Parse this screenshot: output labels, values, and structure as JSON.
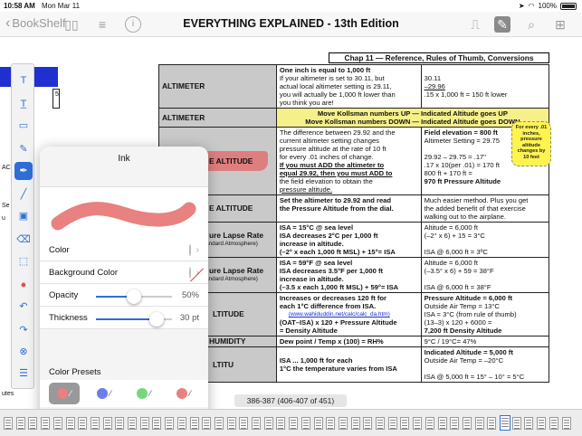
{
  "status": {
    "time": "10:58 AM",
    "date": "Mon Mar 11",
    "battery": "100%"
  },
  "nav": {
    "back_label": "BookShelf",
    "title": "EVERYTHING EXPLAINED - 13th Edition",
    "icons": [
      "book-icon",
      "list-icon",
      "info-icon",
      "bookmark-icon",
      "edit-icon",
      "search-icon",
      "grid-icon"
    ]
  },
  "sheet": {
    "chapter": "Chap 11 — Reference, Rules of Thumb, Conversions",
    "rows": [
      {
        "head": "ALTIMETER",
        "mid": [
          "One inch is equal to 1,000 ft",
          "If your altimeter is set to 30.11, but",
          "actual local altimeter setting is 29.11,",
          "you will actually be 1,000 ft lower than",
          "you think you are!"
        ],
        "right": [
          "  30.11",
          " –29.96",
          "  .15 x 1,000 ft = 150 ft lower"
        ]
      },
      {
        "head": "ALTIMETER",
        "mid": [
          "Move Kollsman numbers UP — Indicated Altitude goes UP",
          "Move Kollsman numbers DOWN — Indicated Altitude goes DOWN"
        ]
      },
      {
        "head": "E ALTITUDE",
        "mid": [
          "The difference between 29.92 and the",
          "current altimeter setting changes",
          "pressure altitude at the rate of 10 ft",
          "for every .01 inches of change.",
          "If you must ADD the altimeter to",
          "equal 29.92, then you must ADD to",
          "the field elevation to obtain the",
          "pressure altitude."
        ],
        "right": [
          "Field elevation = 800 ft",
          "Altimeter Setting = 29.75",
          "",
          "29.92 – 29.75 = .17\"",
          ".17 x 10(per .01) = 170 ft",
          "800 ft + 170 ft =",
          "970 ft Pressure Altitude"
        ]
      },
      {
        "head": "E ALTITUDE",
        "mid": [
          "Set the altimeter to 29.92 and read",
          "the Pressure Altitude from the dial."
        ],
        "right": [
          "Much easier method. Plus you get",
          "the added benefit of that exercise",
          "walking out to the airplane."
        ]
      },
      {
        "head": "ure Lapse Rate",
        "sub": "andard Atmosphere)",
        "mid": [
          "ISA = 15°C @ sea level",
          "ISA decreases 2°C per 1,000 ft",
          "increase in altitude.",
          "(–2° x each 1,000 ft MSL) + 15°= ISA"
        ],
        "right": [
          "Altitude = 6,000 ft",
          "(–2° x 6) + 15 = 3°C",
          "",
          "ISA @ 6,000 ft = 3ºC"
        ]
      },
      {
        "head": "ure Lapse Rate",
        "sub": "andard Atmosphere)",
        "mid": [
          "ISA = 59°F @ sea level",
          "ISA decreases 3.5°F per 1,000 ft",
          "increase in altitude.",
          "(–3.5 x each 1,000 ft MSL) + 59°= ISA"
        ],
        "right": [
          "Altitude = 6,000 ft",
          "(–3.5° x 6) + 59 = 38°F",
          "",
          "ISA @ 6,000 ft = 38°F"
        ]
      },
      {
        "head": "LTITUDE",
        "mid": [
          "Increases or decreases 120 ft for",
          "each 1°C difference from ISA.",
          "(www.wahiduddin.net/calc/calc_da.htm)",
          "(OAT–ISA) x 120 + Pressure Altitude",
          "= Density Altitude"
        ],
        "right": [
          "Pressure Altitude = 6,000 ft",
          "Outside Air Temp = 13°C",
          "ISA = 3°C (from rule of thumb)",
          "(13–3) x 120 + 6000 =",
          "7,200 ft Density Altitude"
        ]
      },
      {
        "head": "HUMIDITY",
        "mid": [
          "Dew point / Temp x (100) = RH%"
        ],
        "right": [
          "9°C / 19°C= 47%"
        ]
      },
      {
        "head": "LTITU",
        "mid": [
          "ISA ... 1,000 ft for each",
          "1°C the temperature varies from ISA"
        ],
        "right": [
          "Indicated Altitude = 5,000 ft",
          "Outside Air Temp = –20°C",
          "",
          "ISA @ 5,000 ft = 15° – 10° = 5°C"
        ]
      }
    ],
    "sticky_note": "For every .01 inches, pressure altitude changes by 10 feet"
  },
  "leftpage": {
    "labels": [
      "5",
      "AC",
      "Se",
      "u",
      "utes"
    ]
  },
  "palette": {
    "tools": [
      "text-box-icon",
      "typewriter-icon",
      "comment-icon",
      "pen-icon",
      "ink-icon",
      "line-icon",
      "image-icon",
      "eraser-icon",
      "selection-icon",
      "record-icon",
      "undo-icon",
      "close-circle-icon",
      "menu-icon"
    ]
  },
  "ink": {
    "title": "Ink",
    "color_label": "Color",
    "bg_label": "Background Color",
    "opacity_label": "Opacity",
    "opacity_value": "50%",
    "opacity_fraction": 0.5,
    "thickness_label": "Thickness",
    "thickness_value": "30 pt",
    "thickness_fraction": 0.8,
    "presets_label": "Color Presets",
    "stroke_color": "#e8817f",
    "presets": [
      {
        "color": "#e8817f",
        "selected": true
      },
      {
        "color": "#6b7ee8",
        "selected": false
      },
      {
        "color": "#7ad67a",
        "selected": false
      },
      {
        "color": "#e8817f",
        "selected": false
      }
    ]
  },
  "page_indicator": "386-387 (406-407 of 451)"
}
